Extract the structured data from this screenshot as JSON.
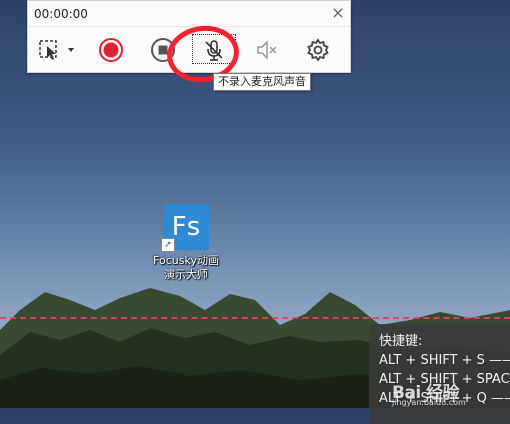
{
  "recorder": {
    "timer": "00:00:00",
    "close_glyph": "×",
    "tools": [
      {
        "name": "region-select-icon"
      },
      {
        "name": "record-icon",
        "color": "#e5202e"
      },
      {
        "name": "stop-icon"
      },
      {
        "name": "microphone-muted-icon"
      },
      {
        "name": "speaker-muted-icon"
      },
      {
        "name": "gear-icon"
      }
    ],
    "tooltip": "不录入麦克风声音"
  },
  "desktop": {
    "icon_glyph": "Fs",
    "icon_label_line1": "Focusky动画",
    "icon_label_line2": "演示大师"
  },
  "shortcuts": {
    "title": "快捷键:",
    "lines": [
      "ALT + SHIFT + S ——",
      "ALT + SHIFT + SPACE",
      "ALT + SHIFT + Q ——"
    ]
  },
  "watermark": {
    "text": "Bai 经验",
    "sub": "jingyan.baidu.com"
  },
  "colors": {
    "annotation": "#ff1e2d",
    "record_line": "#e0445a",
    "app_tile": "#2f8ad6"
  }
}
